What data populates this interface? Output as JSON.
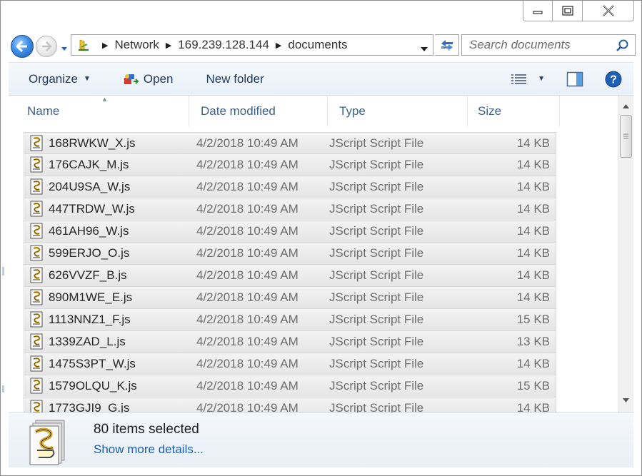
{
  "window": {
    "minimize_symbol": "—",
    "maximize_symbol": "☐",
    "close_symbol": "✕"
  },
  "address": {
    "crumbs": [
      "Network",
      "169.239.128.144",
      "documents"
    ],
    "icon": "network-folder-icon"
  },
  "search": {
    "placeholder": "Search documents"
  },
  "toolbar": {
    "organize_label": "Organize",
    "open_label": "Open",
    "new_folder_label": "New folder"
  },
  "columns": {
    "name": "Name",
    "date": "Date modified",
    "type": "Type",
    "size": "Size"
  },
  "files": [
    {
      "name": "168RWKW_X.js",
      "date": "4/2/2018 10:49 AM",
      "type": "JScript Script File",
      "size": "14 KB"
    },
    {
      "name": "176CAJK_M.js",
      "date": "4/2/2018 10:49 AM",
      "type": "JScript Script File",
      "size": "14 KB"
    },
    {
      "name": "204U9SA_W.js",
      "date": "4/2/2018 10:49 AM",
      "type": "JScript Script File",
      "size": "14 KB"
    },
    {
      "name": "447TRDW_W.js",
      "date": "4/2/2018 10:49 AM",
      "type": "JScript Script File",
      "size": "14 KB"
    },
    {
      "name": "461AH96_W.js",
      "date": "4/2/2018 10:49 AM",
      "type": "JScript Script File",
      "size": "14 KB"
    },
    {
      "name": "599ERJO_O.js",
      "date": "4/2/2018 10:49 AM",
      "type": "JScript Script File",
      "size": "14 KB"
    },
    {
      "name": "626VVZF_B.js",
      "date": "4/2/2018 10:49 AM",
      "type": "JScript Script File",
      "size": "14 KB"
    },
    {
      "name": "890M1WE_E.js",
      "date": "4/2/2018 10:49 AM",
      "type": "JScript Script File",
      "size": "14 KB"
    },
    {
      "name": "1113NNZ1_F.js",
      "date": "4/2/2018 10:49 AM",
      "type": "JScript Script File",
      "size": "15 KB"
    },
    {
      "name": "1339ZAD_L.js",
      "date": "4/2/2018 10:49 AM",
      "type": "JScript Script File",
      "size": "13 KB"
    },
    {
      "name": "1475S3PT_W.js",
      "date": "4/2/2018 10:49 AM",
      "type": "JScript Script File",
      "size": "14 KB"
    },
    {
      "name": "1579OLQU_K.js",
      "date": "4/2/2018 10:49 AM",
      "type": "JScript Script File",
      "size": "15 KB"
    },
    {
      "name": "1773GJI9_G.js",
      "date": "4/2/2018 10:49 AM",
      "type": "JScript Script File",
      "size": "14 KB"
    }
  ],
  "details": {
    "count_text": "80 items selected",
    "more_link": "Show more details..."
  },
  "colors": {
    "accent": "#1a5fb4",
    "command_bar": "#e8eff7",
    "selected_row": "#e9e9e9"
  }
}
